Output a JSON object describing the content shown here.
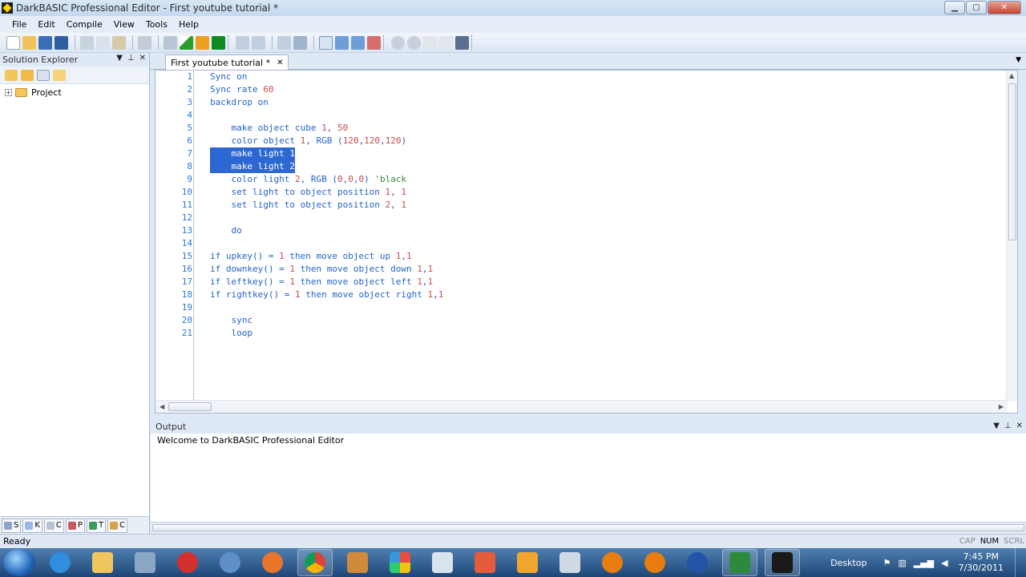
{
  "window": {
    "title": "DarkBASIC Professional Editor - First youtube tutorial *",
    "min": "▁",
    "max": "▢",
    "close": "✕"
  },
  "menu": [
    {
      "label": "File"
    },
    {
      "label": "Edit"
    },
    {
      "label": "Compile"
    },
    {
      "label": "View"
    },
    {
      "label": "Tools"
    },
    {
      "label": "Help"
    }
  ],
  "solution": {
    "title": "Solution Explorer",
    "project": "Project",
    "bottom_tabs": [
      "S",
      "K",
      "C",
      "P",
      "T",
      "C"
    ]
  },
  "doc_tab": {
    "label": "First youtube tutorial *",
    "close": "✕"
  },
  "code_lines": [
    {
      "n": "1",
      "t": "Sync on"
    },
    {
      "n": "2",
      "t": "Sync rate 60"
    },
    {
      "n": "3",
      "t": "backdrop on"
    },
    {
      "n": "4",
      "t": ""
    },
    {
      "n": "5",
      "t": "    make object cube 1, 50"
    },
    {
      "n": "6",
      "t": "    color object 1, RGB (120,120,120)"
    },
    {
      "n": "7",
      "t": "    make light 1"
    },
    {
      "n": "8",
      "t": "    make light 2"
    },
    {
      "n": "9",
      "t": "    color light 2, RGB (0,0,0) 'black"
    },
    {
      "n": "10",
      "t": "    set light to object position 1, 1"
    },
    {
      "n": "11",
      "t": "    set light to object position 2, 1"
    },
    {
      "n": "12",
      "t": ""
    },
    {
      "n": "13",
      "t": "    do"
    },
    {
      "n": "14",
      "t": ""
    },
    {
      "n": "15",
      "t": "if upkey() = 1 then move object up 1,1"
    },
    {
      "n": "16",
      "t": "if downkey() = 1 then move object down 1,1"
    },
    {
      "n": "17",
      "t": "if leftkey() = 1 then move object left 1,1"
    },
    {
      "n": "18",
      "t": "if rightkey() = 1 then move object right 1,1"
    },
    {
      "n": "19",
      "t": ""
    },
    {
      "n": "20",
      "t": "    sync"
    },
    {
      "n": "21",
      "t": "    loop"
    }
  ],
  "selected_lines": [
    7,
    8
  ],
  "output": {
    "title": "Output",
    "message": "Welcome to DarkBASIC Professional Editor"
  },
  "status": {
    "text": "Ready",
    "caps": "CAP",
    "num": "NUM",
    "scrl": "SCRL"
  },
  "taskbar": {
    "desktop_label": "Desktop",
    "time": "7:45 PM",
    "date": "7/30/2011"
  },
  "colors": {
    "keyword": "#2463c8",
    "number": "#c84c4c",
    "comment": "#2f8a3c",
    "selection": "#2d67d2",
    "line_number": "#2b78d6"
  }
}
